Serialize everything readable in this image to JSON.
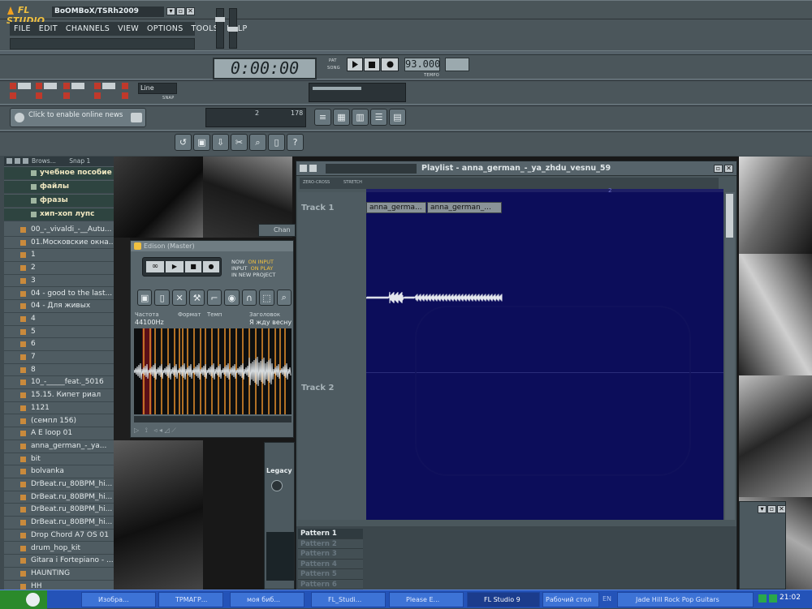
{
  "app": {
    "logo_text": "FL STUDIO",
    "song_title": "BoOMBoX/TSRh2009"
  },
  "menu": [
    "FILE",
    "EDIT",
    "CHANNELS",
    "VIEW",
    "OPTIONS",
    "TOOLS",
    "HELP"
  ],
  "transport": {
    "time": "0:00:00",
    "tempo": "93.000",
    "tempo_label": "TEMPO",
    "pat_label": "PAT",
    "song_label": "SONG"
  },
  "snap": {
    "mode": "Line",
    "label": "SNAP"
  },
  "news": {
    "text": "Click to enable online news"
  },
  "cpu": {
    "value": "2",
    "poly": "178"
  },
  "browser": {
    "title": "Brows...",
    "snap": "Snap 1",
    "folders": [
      "учебное пособие",
      "файлы",
      "фразы",
      "хип-хоп лупс"
    ],
    "items": [
      "00_-_vivaldi_-__Autu...",
      "01.Московские окна...",
      "1",
      "2",
      "3",
      "04 - good to the last...",
      "04 - Для живых",
      "4",
      "5",
      "6",
      "7",
      "8",
      "10_-_____feat._5016",
      "15.15. Кипет риал",
      "1121",
      "(семпл 156)",
      "A E loop 01",
      "anna_german_-_ya...",
      "bit",
      "bolvanka",
      "DrBeat.ru_80BPM_hi...",
      "DrBeat.ru_80BPM_hi...",
      "DrBeat.ru_80BPM_hi...",
      "DrBeat.ru_80BPM_hi...",
      "Drop Chord A7 OS 01",
      "drum_hop_kit",
      "Gitara i Fortepiano - ...",
      "HAUNTING",
      "HH"
    ]
  },
  "edison": {
    "title": "Edison (Master)",
    "options": [
      "NOW",
      "ON INPUT",
      "INPUT",
      "ON PLAY",
      "IN NEW PROJECT"
    ],
    "rate_label": "Частота",
    "rate": "44100Hz",
    "format_label": "Формат",
    "tempo_label": "Темп",
    "title_label": "Заголовок",
    "title_value": "Я жду весну"
  },
  "playlist": {
    "title": "Playlist - anna_german_-_ya_zhdu_vesnu_59",
    "tracks": [
      "Track 1",
      "Track 2"
    ],
    "clips": [
      "anna_germa...",
      "anna_german_..."
    ],
    "ruler_mark": "2",
    "toolbar_labels": [
      "ZERO-CROSS",
      "STRETCH"
    ],
    "patterns": [
      "Pattern 1",
      "Pattern 2",
      "Pattern 3",
      "Pattern 4",
      "Pattern 5",
      "Pattern 6"
    ]
  },
  "channel_fragment": {
    "tab": "Chan",
    "legacy": "Legacy"
  },
  "taskbar": {
    "items": [
      "Изобра...",
      "ТРМАГР...",
      "моя биб...",
      "FL_Studi...",
      "Please E...",
      "FL Studio 9",
      "Рабочий стол",
      "Jade Hill Rock Pop Guitars"
    ],
    "lang": "EN",
    "clock": "21:02"
  },
  "colors": {
    "accent": "#f0c040",
    "playlist_bg": "#0c0d5a",
    "edison_marker": "#e8902c"
  }
}
